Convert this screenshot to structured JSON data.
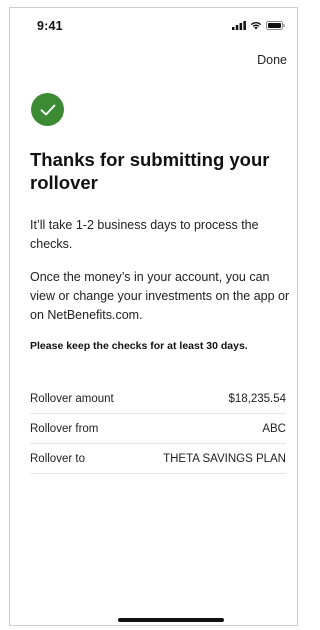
{
  "status_bar": {
    "time": "9:41"
  },
  "header": {
    "done_label": "Done"
  },
  "main": {
    "title": "Thanks for submitting your rollover",
    "paragraph1": "It’ll take 1-2 business days to process the checks.",
    "paragraph2": "Once the money’s in your account, you can view or change your investments on the app or on NetBenefits.com.",
    "note": "Please keep the checks for at least 30 days."
  },
  "details": {
    "rows": [
      {
        "label": "Rollover amount",
        "value": "$18,235.54"
      },
      {
        "label": "Rollover from",
        "value": "ABC"
      },
      {
        "label": "Rollover to",
        "value": "THETA SAVINGS PLAN"
      }
    ]
  },
  "colors": {
    "success": "#3d8a35"
  },
  "icons": [
    "signal-icon",
    "wifi-icon",
    "battery-icon",
    "checkmark-icon"
  ]
}
